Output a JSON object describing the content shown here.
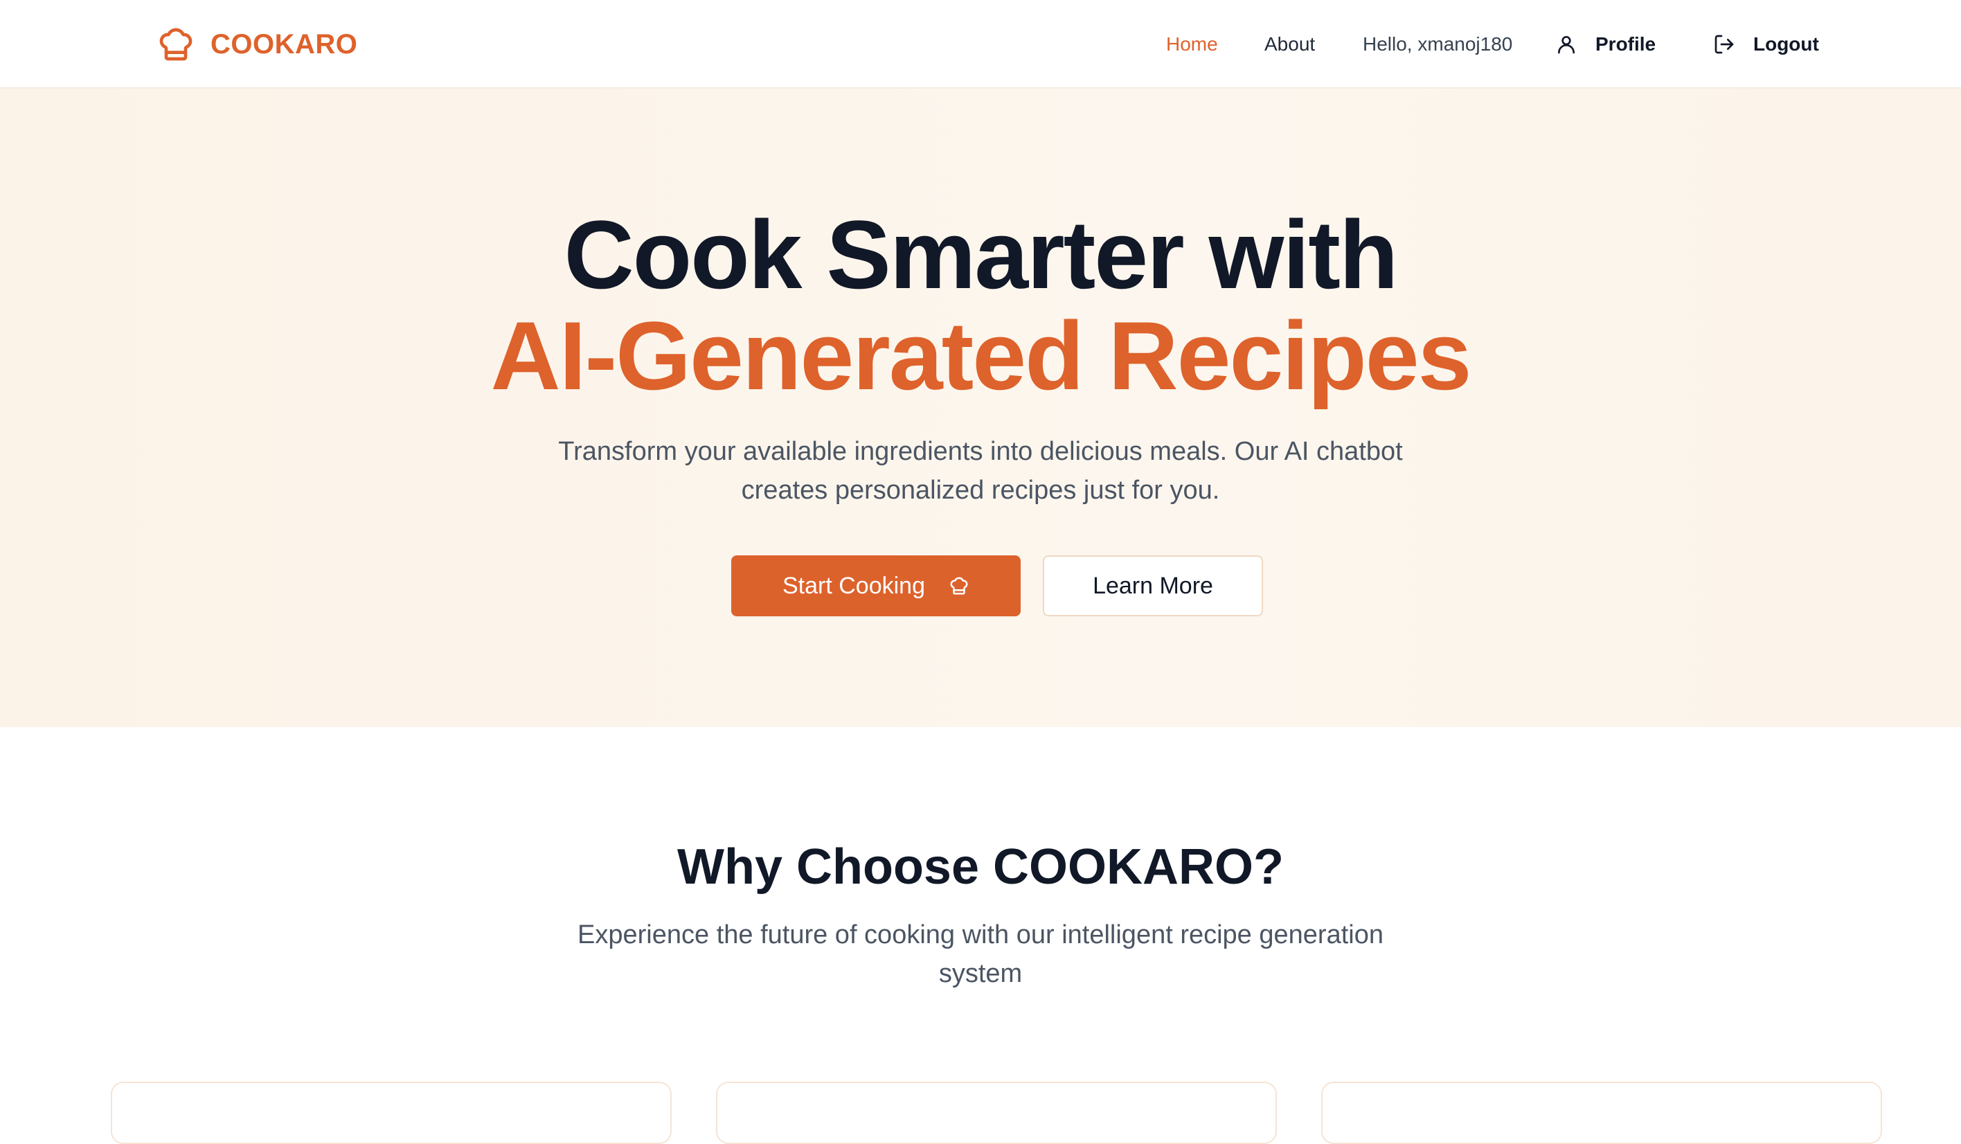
{
  "brand": {
    "name": "COOKARO",
    "icon": "chef-hat-icon",
    "color": "#de622b"
  },
  "nav": {
    "home": "Home",
    "about": "About",
    "greeting": "Hello, xmanoj180",
    "profile": "Profile",
    "profile_icon": "user-icon",
    "logout": "Logout",
    "logout_icon": "logout-icon",
    "active": "Home"
  },
  "hero": {
    "title_line1": "Cook Smarter with",
    "title_line2": "AI-Generated Recipes",
    "subtitle": "Transform your available ingredients into delicious meals. Our AI chatbot creates personalized recipes just for you.",
    "primary_button": "Start Cooking",
    "primary_button_icon": "chef-hat-icon",
    "secondary_button": "Learn More"
  },
  "features": {
    "title": "Why Choose COOKARO?",
    "subtitle": "Experience the future of cooking with our intelligent recipe generation system",
    "cards": [
      {},
      {},
      {}
    ]
  },
  "colors": {
    "accent": "#de622b",
    "hero_background": "#fcf6ee",
    "text_dark": "#111827",
    "text_muted": "#4b5563"
  }
}
